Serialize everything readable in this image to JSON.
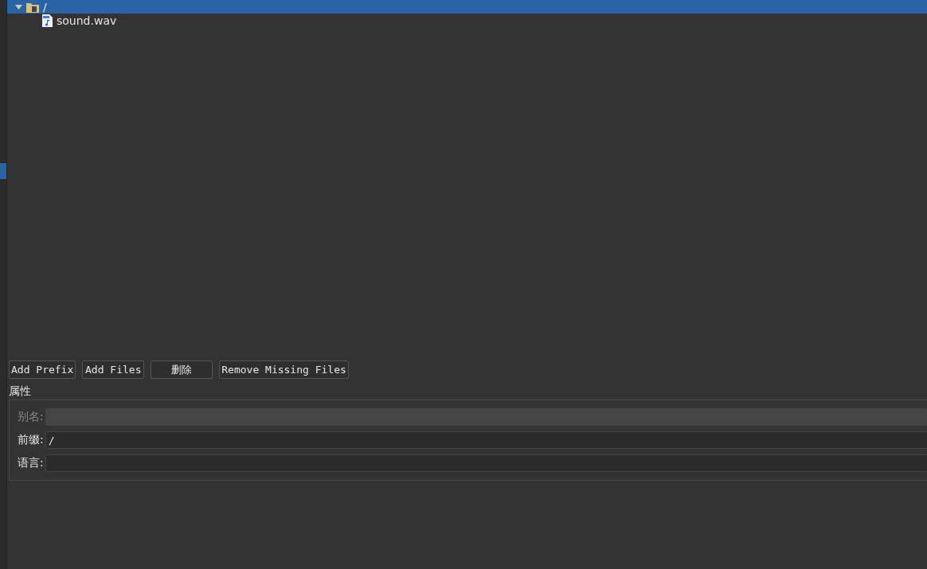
{
  "tree": [
    {
      "label": "/",
      "kind": "folder",
      "selected": true,
      "expanded": true,
      "children": [
        {
          "label": "sound.wav",
          "kind": "file",
          "selected": false
        }
      ]
    }
  ],
  "buttons": [
    "Add Prefix",
    "Add Files",
    "删除",
    "Remove Missing Files"
  ],
  "properties": {
    "title": "属性",
    "fields": [
      {
        "label": "别名:",
        "disabled": true
      },
      {
        "label": "前缀:",
        "value": "/",
        "disabled": false
      },
      {
        "label": "语言:",
        "disabled": false
      }
    ]
  }
}
